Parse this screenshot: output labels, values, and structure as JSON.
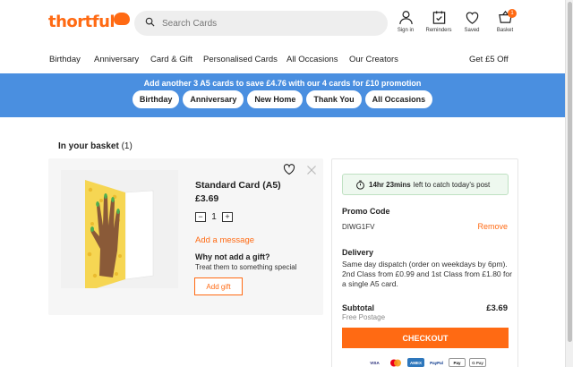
{
  "brand": {
    "logo_text": "thortful",
    "accent": "#ff6a13",
    "banner_color": "#4a8fe0"
  },
  "search": {
    "placeholder": "Search Cards",
    "icon": "search-icon"
  },
  "header_actions": [
    {
      "label": "Sign in",
      "icon": "user-icon"
    },
    {
      "label": "Reminders",
      "icon": "calendar-check-icon"
    },
    {
      "label": "Saved",
      "icon": "heart-icon"
    },
    {
      "label": "Basket",
      "icon": "basket-icon",
      "count": "1"
    }
  ],
  "nav": {
    "items": [
      "Birthday",
      "Anniversary",
      "Card & Gift",
      "Personalised Cards",
      "All Occasions",
      "Our Creators"
    ],
    "right": "Get £5 Off"
  },
  "banner": {
    "text": "Add another 3 A5 cards to save £4.76 with our 4 cards for £10 promotion",
    "pills": [
      "Birthday",
      "Anniversary",
      "New Home",
      "Thank You",
      "All Occasions"
    ]
  },
  "basket": {
    "title": "In your basket",
    "count": "(1)",
    "item": {
      "name": "Standard Card (A5)",
      "price": "£3.69",
      "quantity": "1",
      "qty_minus": "−",
      "qty_plus": "+",
      "add_message": "Add a message",
      "gift_title": "Why not add a gift?",
      "gift_subtitle": "Treat them to something special",
      "gift_button": "Add gift"
    }
  },
  "summary": {
    "post_time": "14hr 23mins",
    "post_text": "left to catch today's post",
    "promo_label": "Promo Code",
    "promo_code": "DIWG1FV",
    "remove": "Remove",
    "delivery_label": "Delivery",
    "delivery_text": "Same day dispatch (order on weekdays by 6pm). 2nd Class from £0.99 and 1st Class from £1.80 for a single A5 card.",
    "subtotal_label": "Subtotal",
    "subtotal_value": "£3.69",
    "shipping_note": "Free Postage",
    "checkout": "CHECKOUT",
    "payments": [
      "VISA",
      "Mastercard",
      "AMEX",
      "PayPal",
      "Apple Pay",
      "G Pay"
    ]
  }
}
